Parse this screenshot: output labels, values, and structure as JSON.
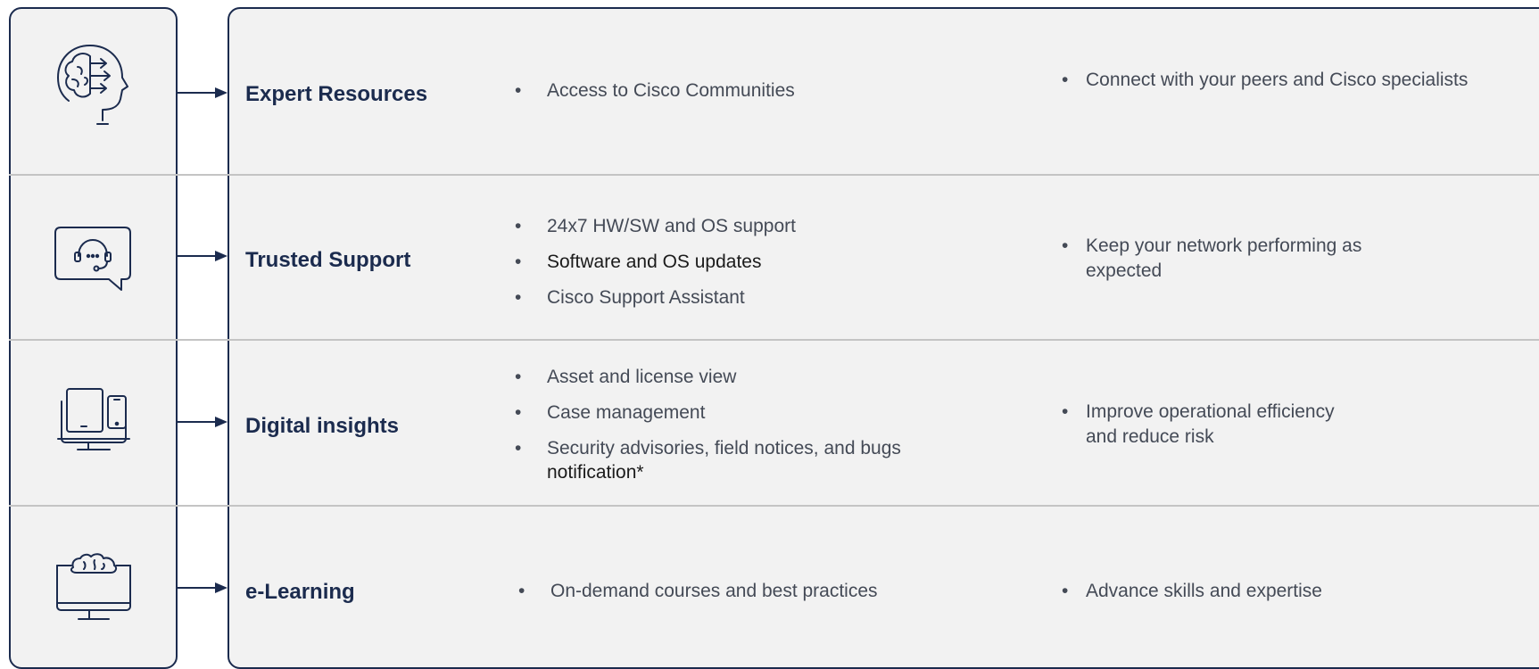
{
  "colors": {
    "navy": "#1b2b4e",
    "panel_bg": "#f2f2f2",
    "divider": "#c4c4c4",
    "text": "#444a56"
  },
  "rows": [
    {
      "icon": "brain-head-icon",
      "category": "Expert Resources",
      "features": [
        "Access to Cisco Communities"
      ],
      "benefit": "Connect with your peers and Cisco specialists"
    },
    {
      "icon": "headset-chat-icon",
      "category": "Trusted Support",
      "features": [
        "24x7 HW/SW and OS support",
        "Software and OS updates",
        "Cisco Support Assistant"
      ],
      "benefit_lines": [
        "Keep your network performing as",
        "expected"
      ]
    },
    {
      "icon": "devices-icon",
      "category": "Digital insights",
      "features": [
        "Asset and license view",
        "Case management"
      ],
      "feature_multiline": [
        "Security advisories, field notices, and bugs",
        "notification*"
      ],
      "benefit_lines": [
        "Improve operational efficiency",
        "and reduce risk"
      ]
    },
    {
      "icon": "cloud-monitor-icon",
      "category": "e-Learning",
      "features": [
        "On-demand courses and best practices"
      ],
      "benefit": "Advance skills and expertise"
    }
  ]
}
